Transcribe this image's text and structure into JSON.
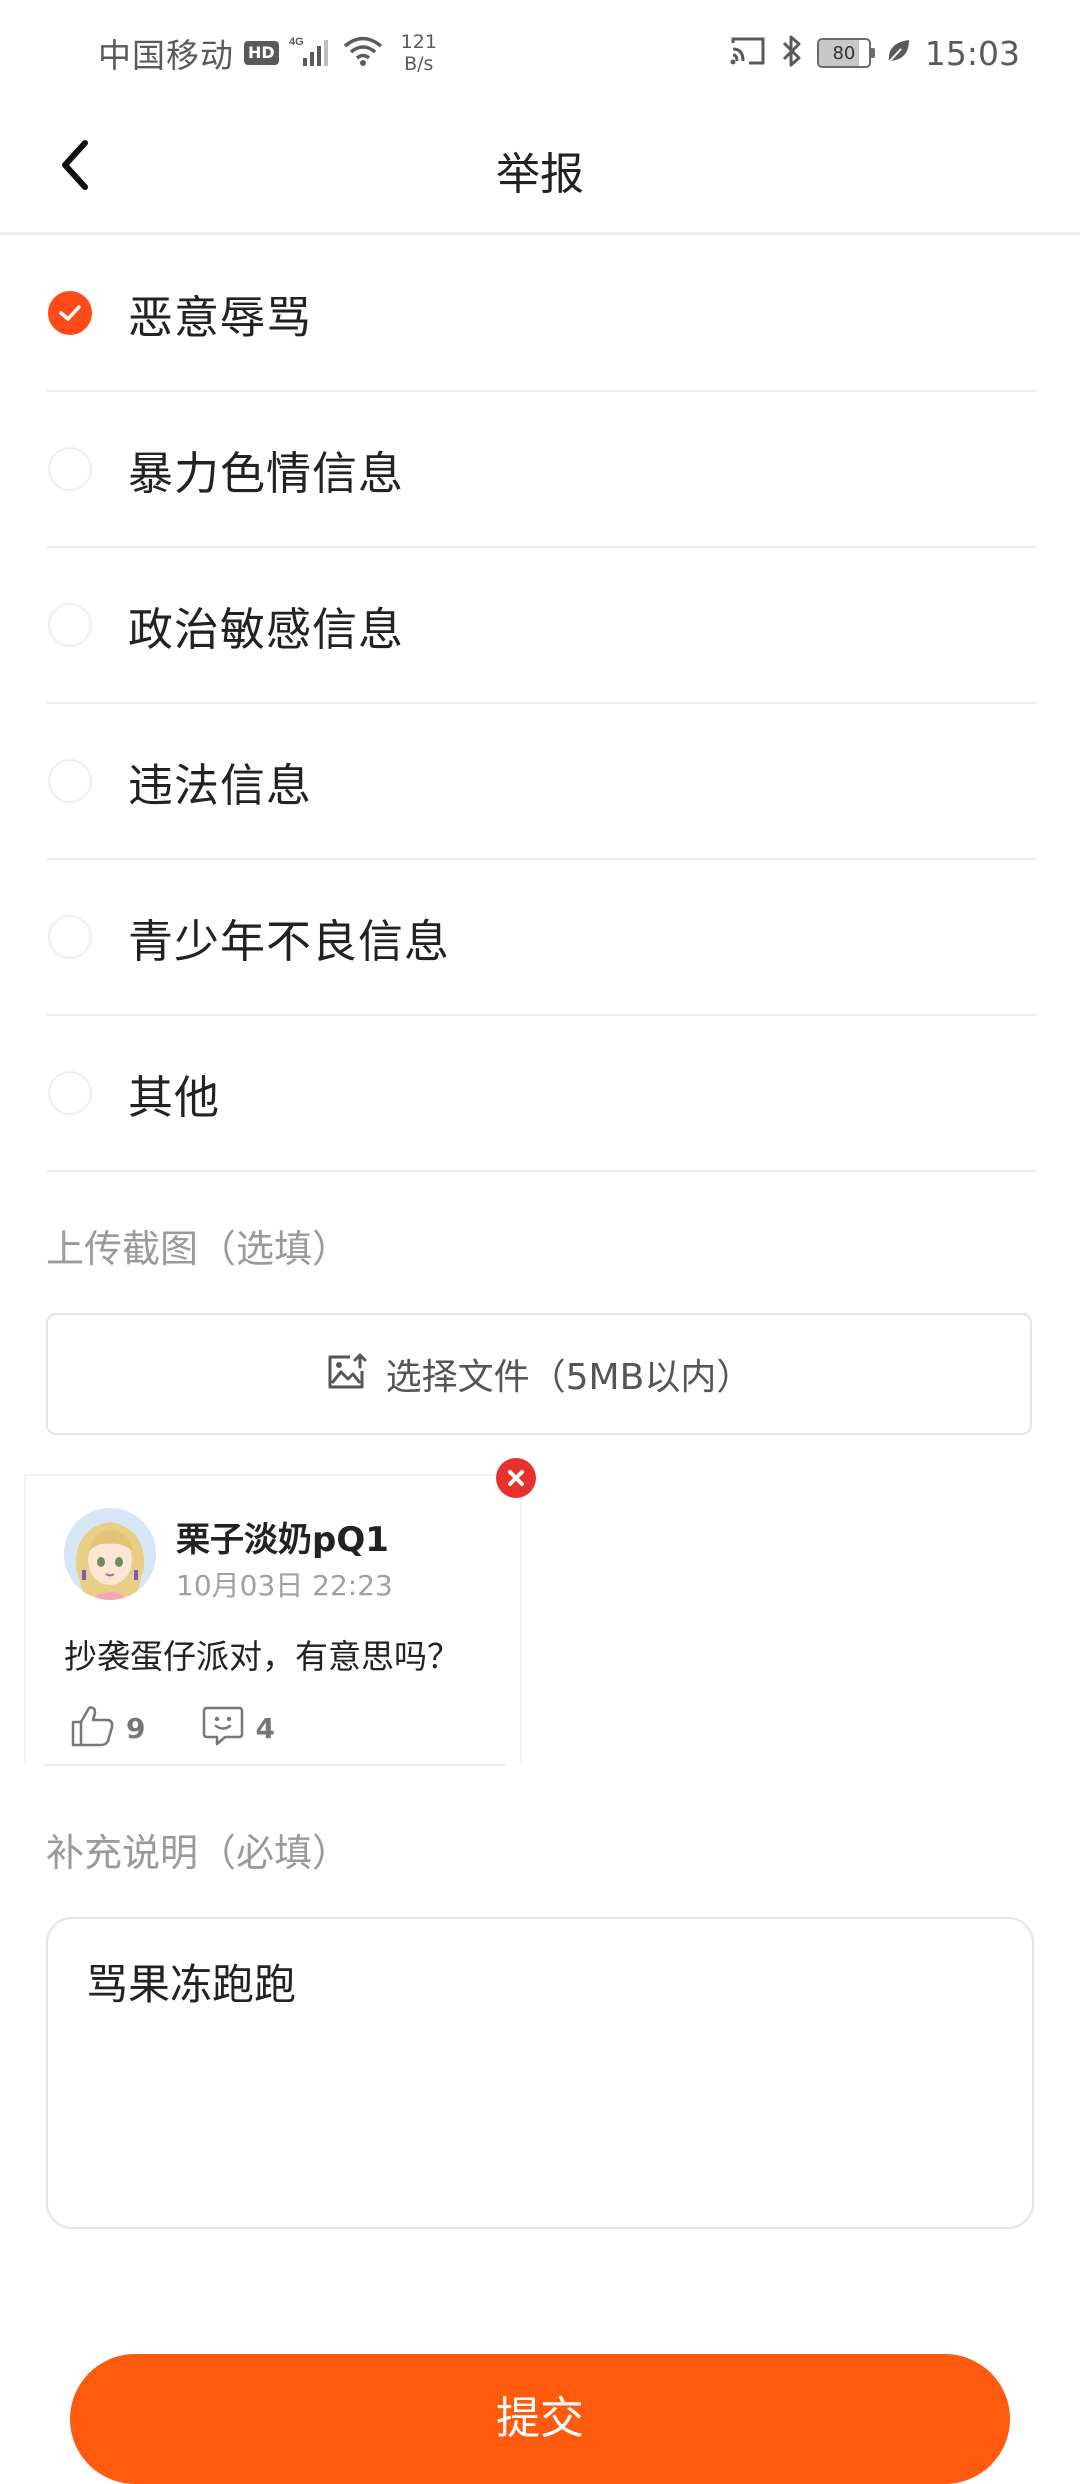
{
  "status_bar": {
    "carrier": "中国移动",
    "hd": "HD",
    "network": "4G",
    "speed_value": "121",
    "speed_unit": "B/s",
    "battery": "80",
    "time": "15:03"
  },
  "header": {
    "title": "举报"
  },
  "reasons": [
    {
      "label": "恶意辱骂",
      "checked": true
    },
    {
      "label": "暴力色情信息",
      "checked": false
    },
    {
      "label": "政治敏感信息",
      "checked": false
    },
    {
      "label": "违法信息",
      "checked": false
    },
    {
      "label": "青少年不良信息",
      "checked": false
    },
    {
      "label": "其他",
      "checked": false
    }
  ],
  "upload": {
    "section_label": "上传截图（选填）",
    "button_label": "选择文件（5MB以内）"
  },
  "comment": {
    "author": "栗子淡奶pQ1",
    "time": "10月03日 22:23",
    "text": "抄袭蛋仔派对，有意思吗？",
    "likes": "9",
    "replies": "4"
  },
  "description": {
    "section_label": "补充说明（必填）",
    "value": "骂果冻跑跑"
  },
  "submit": {
    "label": "提交"
  },
  "colors": {
    "accent": "#ff4b1a",
    "submit": "#ff5a0d",
    "remove": "#e8312c"
  }
}
